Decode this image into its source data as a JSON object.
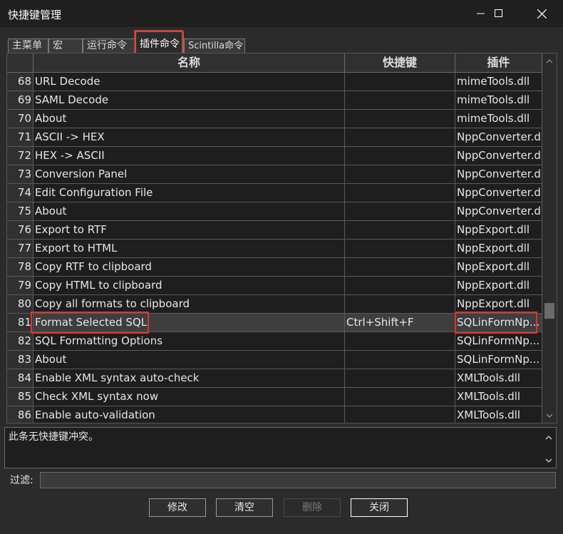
{
  "window": {
    "title": "快捷键管理"
  },
  "tabs": [
    {
      "label": "主菜单",
      "active": false
    },
    {
      "label": "宏",
      "active": false
    },
    {
      "label": "运行命令",
      "active": false
    },
    {
      "label": "插件命令",
      "active": true
    },
    {
      "label": "Scintilla命令",
      "active": false
    }
  ],
  "columns": {
    "name": "名称",
    "shortcut": "快捷键",
    "plugin": "插件"
  },
  "rows": [
    {
      "num": "68",
      "name": "URL Decode",
      "shortcut": "",
      "plugin": "mimeTools.dll"
    },
    {
      "num": "69",
      "name": "SAML Decode",
      "shortcut": "",
      "plugin": "mimeTools.dll"
    },
    {
      "num": "70",
      "name": "About",
      "shortcut": "",
      "plugin": "mimeTools.dll"
    },
    {
      "num": "71",
      "name": "ASCII -> HEX",
      "shortcut": "",
      "plugin": "NppConverter.dll"
    },
    {
      "num": "72",
      "name": "HEX -> ASCII",
      "shortcut": "",
      "plugin": "NppConverter.dll"
    },
    {
      "num": "73",
      "name": "Conversion Panel",
      "shortcut": "",
      "plugin": "NppConverter.dll"
    },
    {
      "num": "74",
      "name": "Edit Configuration File",
      "shortcut": "",
      "plugin": "NppConverter.dll"
    },
    {
      "num": "75",
      "name": "About",
      "shortcut": "",
      "plugin": "NppConverter.dll"
    },
    {
      "num": "76",
      "name": "Export to RTF",
      "shortcut": "",
      "plugin": "NppExport.dll"
    },
    {
      "num": "77",
      "name": "Export to HTML",
      "shortcut": "",
      "plugin": "NppExport.dll"
    },
    {
      "num": "78",
      "name": "Copy RTF to clipboard",
      "shortcut": "",
      "plugin": "NppExport.dll"
    },
    {
      "num": "79",
      "name": "Copy HTML to clipboard",
      "shortcut": "",
      "plugin": "NppExport.dll"
    },
    {
      "num": "80",
      "name": "Copy all formats to clipboard",
      "shortcut": "",
      "plugin": "NppExport.dll"
    },
    {
      "num": "81",
      "name": "Format Selected SQL",
      "shortcut": "Ctrl+Shift+F",
      "plugin": "SQLinFormNp...",
      "selected": true
    },
    {
      "num": "82",
      "name": "SQL Formatting Options",
      "shortcut": "",
      "plugin": "SQLinFormNp..."
    },
    {
      "num": "83",
      "name": "About",
      "shortcut": "",
      "plugin": "SQLinFormNp..."
    },
    {
      "num": "84",
      "name": "Enable XML syntax auto-check",
      "shortcut": "",
      "plugin": "XMLTools.dll"
    },
    {
      "num": "85",
      "name": "Check XML syntax now",
      "shortcut": "",
      "plugin": "XMLTools.dll"
    },
    {
      "num": "86",
      "name": "Enable auto-validation",
      "shortcut": "",
      "plugin": "XMLTools.dll"
    }
  ],
  "message": "此条无快捷键冲突。",
  "filter": {
    "label": "过滤:",
    "value": ""
  },
  "buttons": {
    "modify": "修改",
    "clear": "清空",
    "delete": "删除",
    "close": "关闭"
  }
}
